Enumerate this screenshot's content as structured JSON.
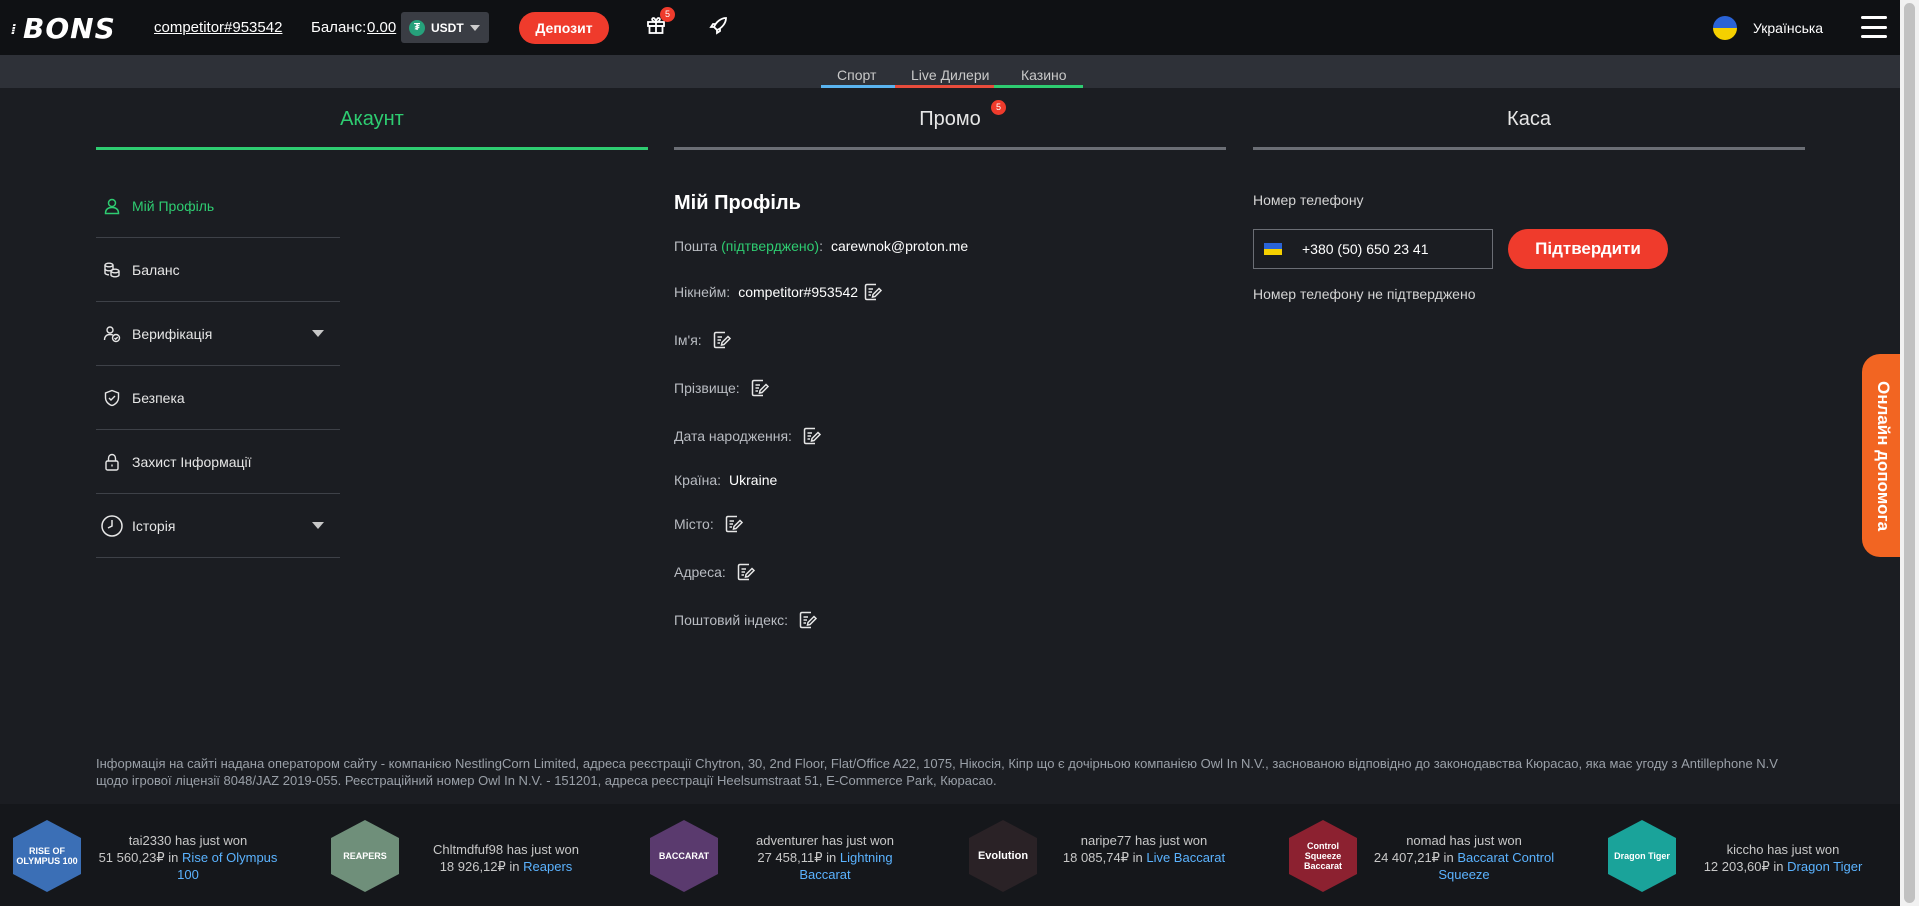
{
  "header": {
    "logo": "BONS",
    "username": "competitor#953542",
    "balance_label": "Баланс:",
    "balance_value": "0.00",
    "currency": "USDT",
    "deposit_label": "Депозит",
    "gift_count": "5",
    "language": "Українська"
  },
  "subnav": [
    {
      "label": "Спорт",
      "color": "#5ab4f0"
    },
    {
      "label": "Live Дилери",
      "color": "#e74c3c"
    },
    {
      "label": "Казино",
      "color": "#2ecc71"
    }
  ],
  "tabs": [
    {
      "label": "Акаунт",
      "color": "#2ecc71"
    },
    {
      "label": "Промо",
      "color": "#6b6e75",
      "badge": "5"
    },
    {
      "label": "Каса",
      "color": "#6b6e75"
    }
  ],
  "sidebar": {
    "items": [
      {
        "label": "Мій Профіль",
        "icon": "user-icon",
        "active": true
      },
      {
        "label": "Баланс",
        "icon": "coins-icon"
      },
      {
        "label": "Верифікація",
        "icon": "user-check-icon",
        "expandable": true
      },
      {
        "label": "Безпека",
        "icon": "shield-icon"
      },
      {
        "label": "Захист Інформації",
        "icon": "lock-icon"
      },
      {
        "label": "Історія",
        "icon": "clock-icon",
        "expandable": true
      }
    ]
  },
  "profile": {
    "title": "Мій Профіль",
    "email_label": "Пошта",
    "email_status": "(підтверджено)",
    "email_colon": ":",
    "email": "carewnok@proton.me",
    "nickname_label": "Нікнейм:",
    "nickname": "competitor#953542",
    "first_name_label": "Ім'я:",
    "last_name_label": "Прізвище:",
    "birthdate_label": "Дата народження:",
    "country_label": "Країна:",
    "country": "Ukraine",
    "city_label": "Місто:",
    "address_label": "Адреса:",
    "postcode_label": "Поштовий індекс:"
  },
  "phone": {
    "label": "Номер телефону",
    "value": "+380 (50) 650 23 41",
    "confirm_label": "Підтвердити",
    "status": "Номер телефону не підтверджено"
  },
  "help_label": "Онлайн допомога",
  "legal": "Інформація на сайті надана оператором сайту - компанією NestlingCorn Limited, адреса реєстрації Chytron, 30, 2nd Floor, Flat/Office A22, 1075, Нікосія, Кіпр що є дочірньою компанією Owl In N.V., заснованою відповідно до законодавства Кюрасао, яка має угоду з Antillephone N.V щодо ігрової ліцензії 8048/JAZ 2019-055. Реєстраційний номер Owl In N.V. - 151201, адреса реєстрації Heelsumstraat 51, E-Commerce Park, Кюрасао.",
  "winners": [
    {
      "user": "tai2330 has just won",
      "amount": "51 560,23₽ in",
      "game": "Rise of Olympus 100",
      "thumb": "RISE OF OLYMPUS 100",
      "bg": "#3b6fb6"
    },
    {
      "user": "Chltmdfuf98 has just won",
      "amount": "18 926,12₽ in",
      "game": "Reapers",
      "thumb": "REAPERS",
      "bg": "#6f8f7a"
    },
    {
      "user": "adventurer has just won",
      "amount": "27 458,11₽ in",
      "game": "Lightning Baccarat",
      "thumb": "BACCARAT",
      "bg": "#5a3a6e"
    },
    {
      "user": "naripe77 has just won",
      "amount": "18 085,74₽ in",
      "game": "Live Baccarat",
      "thumb": "Evolution",
      "bg": "#2a2226"
    },
    {
      "user": "nomad has just won",
      "amount": "24 407,21₽ in",
      "game": "Baccarat Control Squeeze",
      "thumb": "Control Squeeze Baccarat",
      "bg": "#8c2130"
    },
    {
      "user": "kiccho has just won",
      "amount": "12 203,60₽ in",
      "game": "Dragon Tiger",
      "thumb": "Dragon Tiger",
      "bg": "#1aa39a"
    }
  ]
}
